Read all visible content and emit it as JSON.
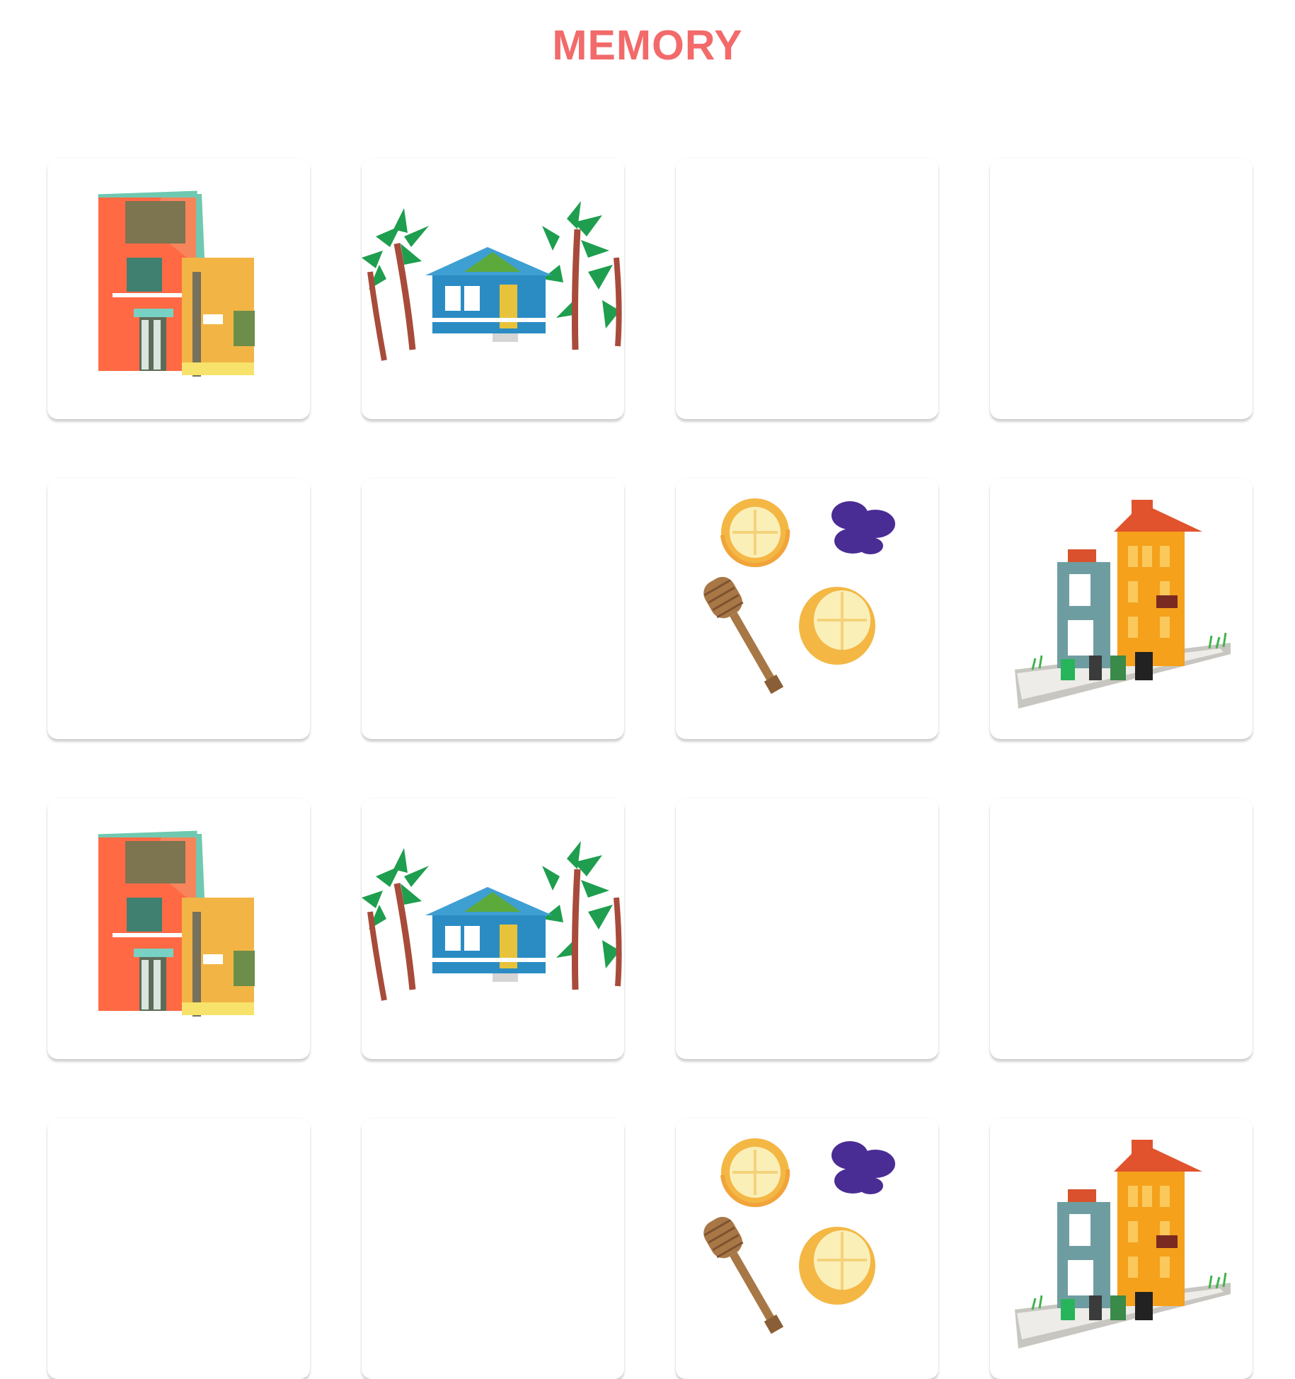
{
  "header": {
    "title": "MEMORY"
  },
  "colors": {
    "title": "#F26A6A",
    "card_face": "#ffffff"
  },
  "cards": [
    {
      "state": "face-up",
      "picture": "colorful-townhouses"
    },
    {
      "state": "face-up",
      "picture": "beach-house-palms"
    },
    {
      "state": "face-down",
      "picture": ""
    },
    {
      "state": "face-down",
      "picture": ""
    },
    {
      "state": "face-down",
      "picture": ""
    },
    {
      "state": "face-down",
      "picture": ""
    },
    {
      "state": "face-up",
      "picture": "lemons-honey-flower"
    },
    {
      "state": "face-up",
      "picture": "orange-tower-houses"
    },
    {
      "state": "face-up",
      "picture": "colorful-townhouses"
    },
    {
      "state": "face-up",
      "picture": "beach-house-palms"
    },
    {
      "state": "face-down",
      "picture": ""
    },
    {
      "state": "face-down",
      "picture": ""
    },
    {
      "state": "face-down",
      "picture": ""
    },
    {
      "state": "face-down",
      "picture": ""
    },
    {
      "state": "face-up",
      "picture": "lemons-honey-flower"
    },
    {
      "state": "face-up",
      "picture": "orange-tower-houses"
    }
  ]
}
